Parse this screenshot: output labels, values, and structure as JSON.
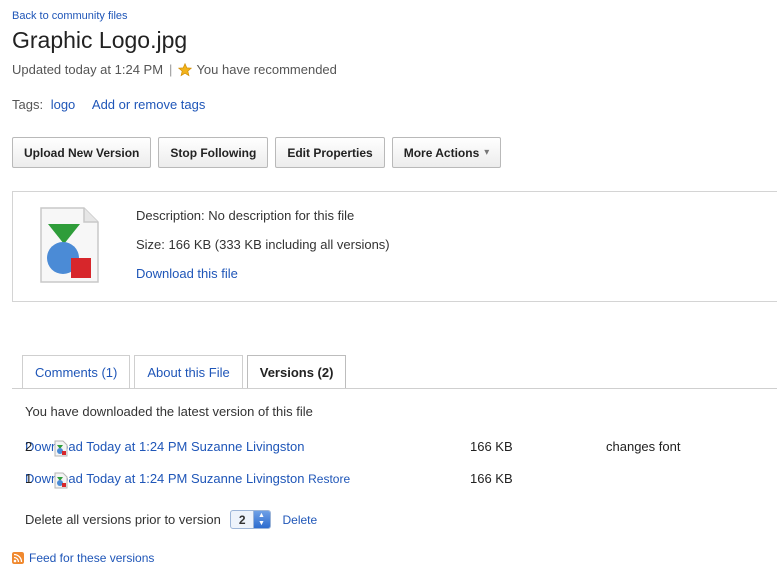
{
  "header": {
    "back_link": "Back to community files",
    "title": "Graphic Logo.jpg",
    "updated": "Updated today at 1:24 PM",
    "separator": "|",
    "recommended": "You have recommended"
  },
  "tags": {
    "label": "Tags:",
    "items": [
      "logo"
    ],
    "add_remove": "Add or remove tags"
  },
  "toolbar": {
    "upload": "Upload New Version",
    "stop_following": "Stop Following",
    "edit_properties": "Edit Properties",
    "more_actions": "More Actions",
    "more_caret": "▾"
  },
  "file_info": {
    "description": "Description: No description for this file",
    "size": "Size: 166 KB (333 KB including all versions)",
    "download": "Download this file",
    "icon": "image-file-icon"
  },
  "tabs": [
    {
      "label": "Comments (1)",
      "active": false
    },
    {
      "label": "About this File",
      "active": false
    },
    {
      "label": "Versions (2)",
      "active": true
    }
  ],
  "versions": {
    "message": "You have downloaded the latest version of this file",
    "rows": [
      {
        "num": "2",
        "download": "Download",
        "date": "Today at 1:24 PM",
        "author": "Suzanne Livingston",
        "size": "166 KB",
        "restore": "",
        "comment": "changes font"
      },
      {
        "num": "1",
        "download": "Download",
        "date": "Today at 1:24 PM",
        "author": "Suzanne Livingston",
        "size": "166 KB",
        "restore": "Restore",
        "comment": ""
      }
    ],
    "delete_label": "Delete all versions prior to version",
    "delete_value": "2",
    "delete_link": "Delete",
    "feed": "Feed for these versions"
  },
  "colors": {
    "link": "#1f56b8",
    "star": "#f2b31b",
    "feed": "#f0892f"
  }
}
